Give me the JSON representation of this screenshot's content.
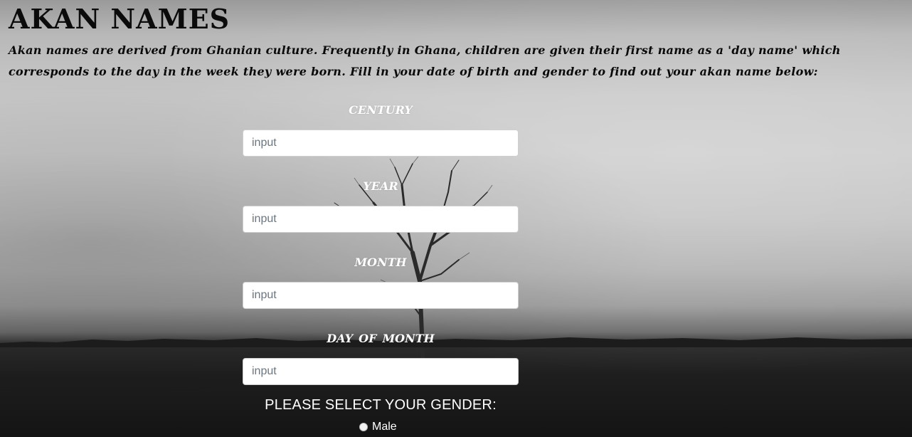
{
  "page": {
    "title": "AKAN NAMES",
    "intro": "Akan names are derived from Ghanian culture. Frequently in Ghana, children are given their first name as a 'day name' which corresponds to the day in the week they were born. Fill in your date of birth and gender to find out your akan name below:"
  },
  "form": {
    "century": {
      "label": "century",
      "placeholder": "input",
      "value": ""
    },
    "year": {
      "label": "year",
      "placeholder": "input",
      "value": ""
    },
    "month": {
      "label": "month",
      "placeholder": "input",
      "value": ""
    },
    "day": {
      "label": "day of Month",
      "placeholder": "input",
      "value": ""
    },
    "gender": {
      "title": "PLEASE SELECT YOUR GENDER:",
      "options": [
        {
          "label": "Male",
          "selected": false
        }
      ]
    }
  },
  "theme": {
    "label_color": "#ffffff",
    "title_color": "#0b0b0b",
    "input_border": "#cfcfcf"
  }
}
